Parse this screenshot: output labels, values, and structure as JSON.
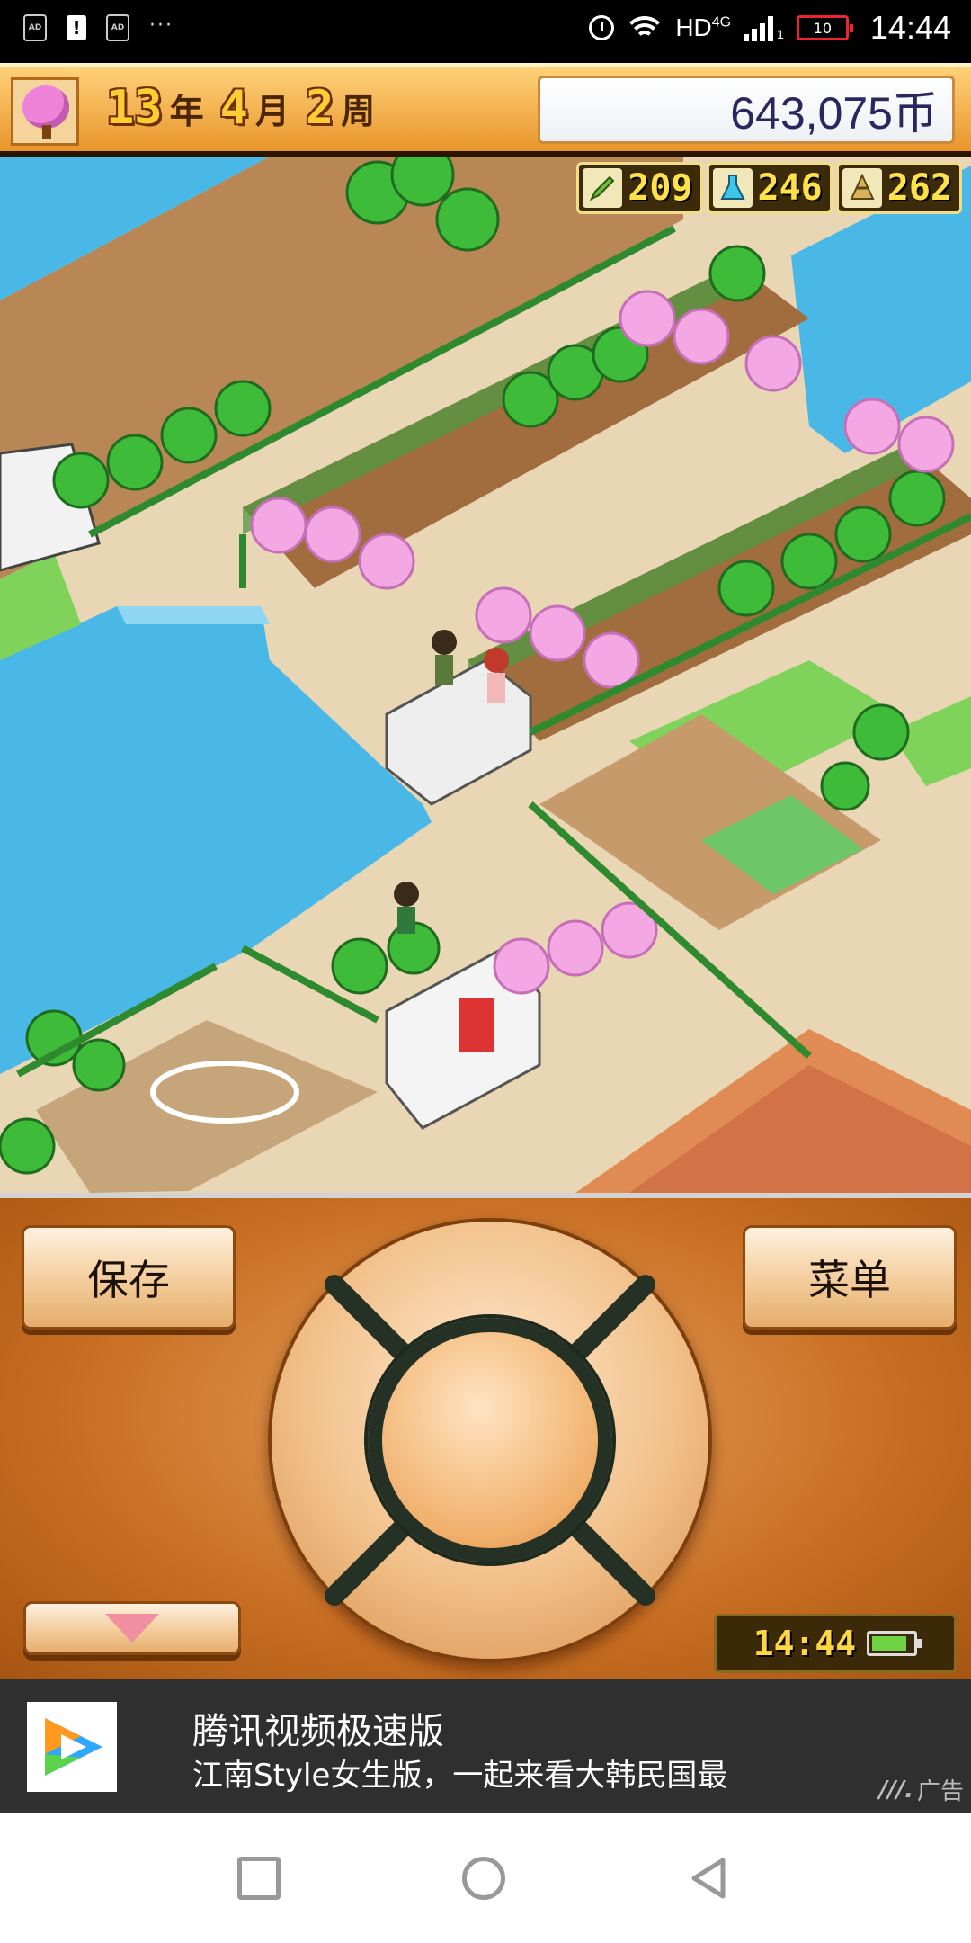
{
  "status_bar": {
    "ad_icon": "AD",
    "dots": "···",
    "network_label": "HD",
    "network_type": "4G",
    "sim": "1",
    "battery": "10",
    "time": "14:44"
  },
  "header": {
    "year_num": "13",
    "year_unit": "年",
    "month_num": "4",
    "month_unit": "月",
    "week_num": "2",
    "week_unit": "周",
    "money": "643,075币"
  },
  "resources": [
    {
      "icon": "pencil-icon",
      "value": "209"
    },
    {
      "icon": "flask-icon",
      "value": "246"
    },
    {
      "icon": "cone-icon",
      "value": "262"
    }
  ],
  "controls": {
    "save_label": "保存",
    "menu_label": "菜单",
    "clock": "14:44"
  },
  "ad": {
    "title": "腾讯视频极速版",
    "subtitle": "江南Style女生版，一起来看大韩民国最",
    "tag": "广告"
  },
  "colors": {
    "header_gold": "#e9952c",
    "controller_orange": "#c76e22",
    "water": "#48b9e8",
    "grass": "#7fd35b",
    "digits_yellow": "#ffcc33"
  }
}
